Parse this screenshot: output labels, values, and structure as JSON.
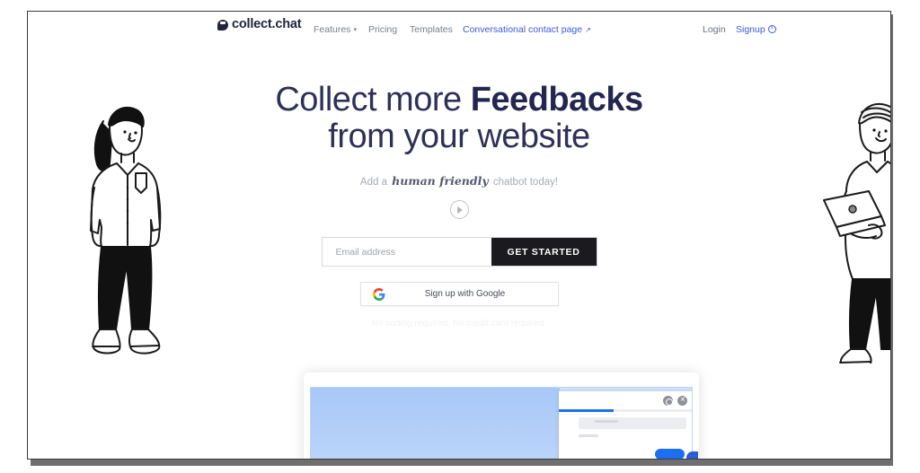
{
  "nav": {
    "logo_text": "collect.chat",
    "logo_icon": "chat-bubble-icon",
    "features": "Features",
    "features_chevron": "▾",
    "pricing": "Pricing",
    "templates": "Templates",
    "contact_page": "Conversational contact page",
    "contact_external_icon": "↗",
    "login": "Login",
    "signup": "Signup"
  },
  "hero": {
    "headline_line1_light": "Collect more ",
    "headline_line1_strong": "Feedbacks",
    "headline_line2": "from your website",
    "subtitle_prefix": "Add a ",
    "subtitle_script": "human friendly",
    "subtitle_suffix": " chatbot today!",
    "play_icon": "play-circle-icon"
  },
  "form": {
    "email_placeholder": "Email address",
    "email_value": "",
    "get_started_label": "GET STARTED",
    "google_label": "Sign up with Google",
    "google_icon": "google-g-icon",
    "fineprint": "No coding required. No credit card required."
  },
  "mockup": {
    "widget_gear_icon": "gear-icon",
    "widget_close_icon": "close-icon",
    "send_button_label": "",
    "launcher_label": ""
  },
  "illustrations": {
    "left_alt": "person-standing-illustration",
    "right_alt": "person-with-laptop-illustration"
  },
  "colors": {
    "headline": "#2e3157",
    "accent_blue": "#3b5bdb",
    "widget_blue": "#1d6ff2",
    "button_dark": "#1b1b1f"
  }
}
